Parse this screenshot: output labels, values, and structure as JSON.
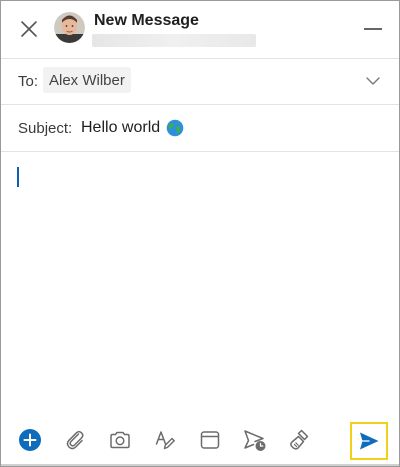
{
  "header": {
    "title": "New Message"
  },
  "to_row": {
    "label": "To:",
    "recipient": "Alex Wilber"
  },
  "subject_row": {
    "label": "Subject:",
    "value": "Hello world"
  },
  "toolbar": {
    "items": [
      "add-icon",
      "attach-icon",
      "camera-icon",
      "format-text-icon",
      "calendar-icon",
      "schedule-send-icon",
      "clear-formatting-icon"
    ],
    "send_icon": "send-icon"
  },
  "colors": {
    "accent": "#0f6cbd",
    "send_highlight": "#f2d017",
    "icon_gray": "#6b6b6b"
  }
}
